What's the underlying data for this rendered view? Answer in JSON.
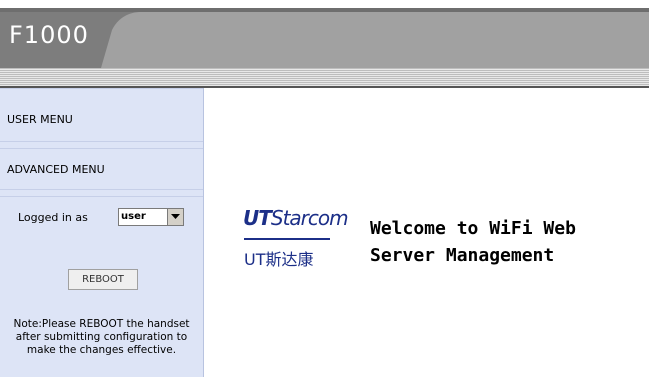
{
  "header": {
    "title": "F1000"
  },
  "sidebar": {
    "user_menu": "USER MENU",
    "advanced_menu": "ADVANCED MENU",
    "logged_in_label": "Logged in as",
    "logged_in_user": "user",
    "reboot_label": "REBOOT",
    "note": "Note:Please REBOOT the handset after submitting configuration to make the changes effective."
  },
  "main": {
    "logo_ut": "UT",
    "logo_starcom": "Starcom",
    "logo_chinese": "UT斯达康",
    "welcome_line1": "Welcome to WiFi Web",
    "welcome_line2": "Server Management"
  },
  "colors": {
    "sidebar_bg": "#dde4f6",
    "header_bar": "#a1a1a1",
    "logo_blue": "#1c2f88"
  }
}
